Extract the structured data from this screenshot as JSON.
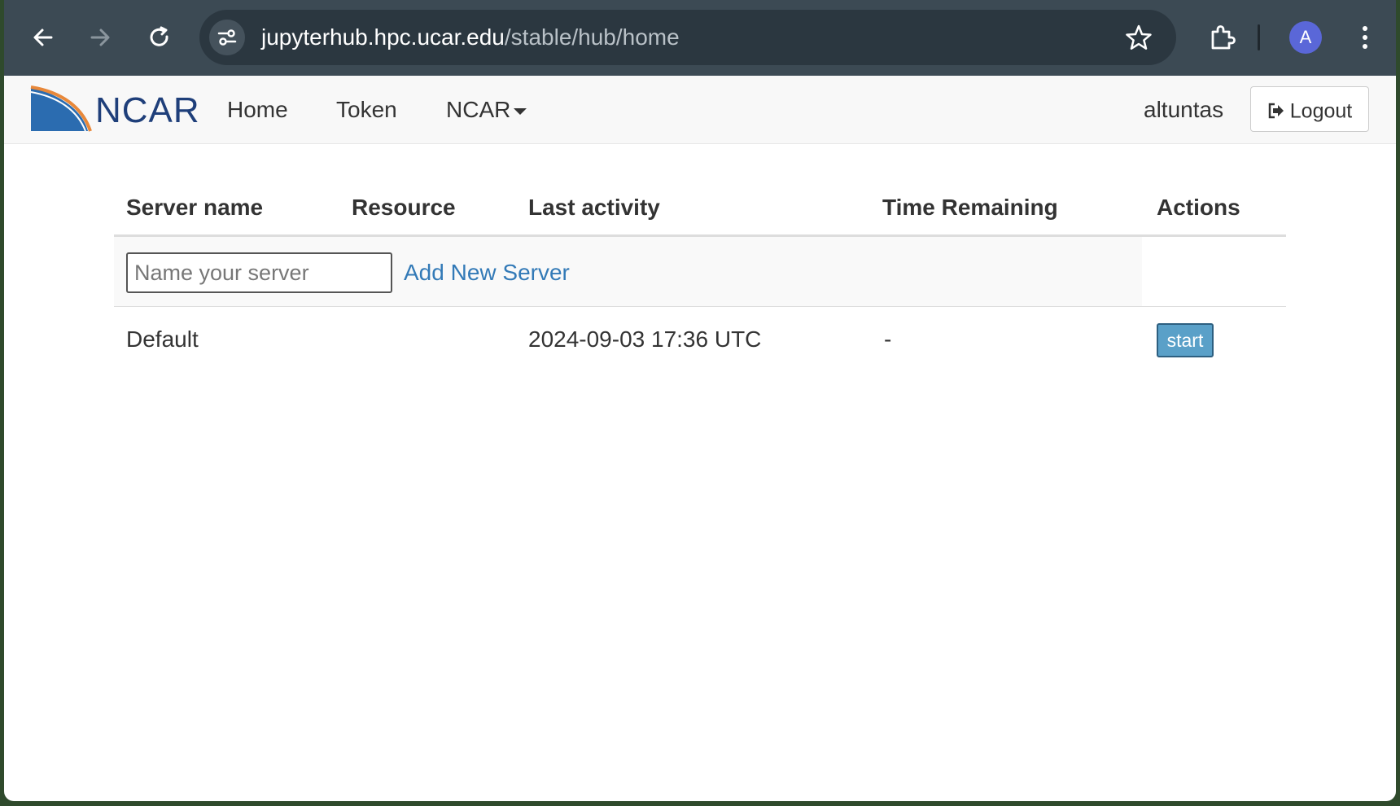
{
  "browser": {
    "url_host": "jupyterhub.hpc.ucar.edu",
    "url_path": "/stable/hub/home",
    "profile_initial": "A",
    "icons": [
      "back-arrow-icon",
      "forward-arrow-icon",
      "reload-icon",
      "site-settings-icon",
      "star-icon",
      "extensions-icon",
      "kebab-menu-icon"
    ]
  },
  "navbar": {
    "logo_text": "NCAR",
    "links": [
      "Home",
      "Token",
      "NCAR"
    ],
    "username": "altuntas",
    "logout_label": "Logout"
  },
  "table": {
    "headers": [
      "Server name",
      "Resource",
      "Last activity",
      "Time Remaining",
      "Actions"
    ],
    "new_server": {
      "placeholder": "Name your server",
      "add_label": "Add New Server"
    },
    "rows": [
      {
        "server_name": "Default",
        "resource": "",
        "last_activity": "2024-09-03 17:36 UTC",
        "time_remaining": "-",
        "action": "start"
      }
    ]
  },
  "colors": {
    "topbar": "#3c4a54",
    "link": "#337ab7",
    "start_button": "#5aa0c8",
    "logo_blue": "#1f3f7a",
    "logo_orange": "#e8883a"
  }
}
